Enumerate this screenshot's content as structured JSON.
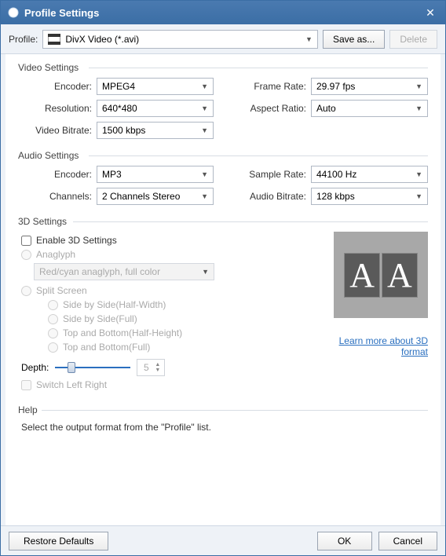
{
  "title": "Profile Settings",
  "toolbar": {
    "profile_label": "Profile:",
    "profile_value": "DivX Video (*.avi)",
    "save_as": "Save as...",
    "delete": "Delete"
  },
  "video": {
    "group": "Video Settings",
    "encoder_label": "Encoder:",
    "encoder": "MPEG4",
    "resolution_label": "Resolution:",
    "resolution": "640*480",
    "bitrate_label": "Video Bitrate:",
    "bitrate": "1500 kbps",
    "framerate_label": "Frame Rate:",
    "framerate": "29.97 fps",
    "aspect_label": "Aspect Ratio:",
    "aspect": "Auto"
  },
  "audio": {
    "group": "Audio Settings",
    "encoder_label": "Encoder:",
    "encoder": "MP3",
    "channels_label": "Channels:",
    "channels": "2 Channels Stereo",
    "samplerate_label": "Sample Rate:",
    "samplerate": "44100 Hz",
    "bitrate_label": "Audio Bitrate:",
    "bitrate": "128 kbps"
  },
  "three_d": {
    "group": "3D Settings",
    "enable": "Enable 3D Settings",
    "anaglyph": "Anaglyph",
    "anaglyph_mode": "Red/cyan anaglyph, full color",
    "split": "Split Screen",
    "sbs_half": "Side by Side(Half-Width)",
    "sbs_full": "Side by Side(Full)",
    "tb_half": "Top and Bottom(Half-Height)",
    "tb_full": "Top and Bottom(Full)",
    "depth_label": "Depth:",
    "depth_value": "5",
    "switch_lr": "Switch Left Right",
    "learn_more": "Learn more about 3D format",
    "preview_a": "A",
    "preview_b": "A"
  },
  "help": {
    "group": "Help",
    "text": "Select the output format from the \"Profile\" list."
  },
  "footer": {
    "restore": "Restore Defaults",
    "ok": "OK",
    "cancel": "Cancel"
  }
}
